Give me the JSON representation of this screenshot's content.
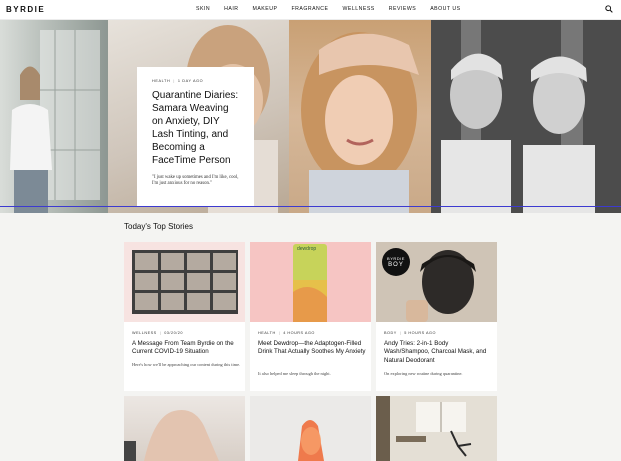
{
  "header": {
    "logo": "BYRDIE",
    "nav": [
      "SKIN",
      "HAIR",
      "MAKEUP",
      "FRAGRANCE",
      "WELLNESS",
      "REVIEWS",
      "ABOUT US"
    ],
    "search_icon": "search-icon"
  },
  "hero": {
    "category": "HEALTH",
    "time": "1 DAY AGO",
    "title": "Quarantine Diaries: Samara Weaving on Anxiety, DIY Lash Tinting, and Becoming a FaceTime Person",
    "quote": "\"I just wake up sometimes and I'm like, cool, I'm just anxious for no reason.\""
  },
  "section": {
    "title": "Today's Top Stories"
  },
  "stories": [
    {
      "category": "WELLNESS",
      "time": "03/20/20",
      "title": "A Message From Team Byrdie on the Current COVID-19 Situation",
      "desc": "Here's how we'll be approaching our content during this time."
    },
    {
      "category": "HEALTH",
      "time": "4 HOURS AGO",
      "title": "Meet Dewdrop—the Adaptogen-Filled Drink That Actually Soothes My Anxiety",
      "desc": "It also helped me sleep through the night.",
      "can_label": "dewdrop"
    },
    {
      "category": "BODY",
      "time": "5 HOURS AGO",
      "title": "Andy Tries: 2-in-1 Body Wash/Shampoo, Charcoal Mask, and Natural Deodorant",
      "desc": "On exploring new routine during quarantine.",
      "badge_top": "BYRDIE",
      "badge_bottom": "BOY"
    }
  ],
  "colors": {
    "accent_line": "#3d3ad0",
    "pink": "#f6c5c3"
  }
}
